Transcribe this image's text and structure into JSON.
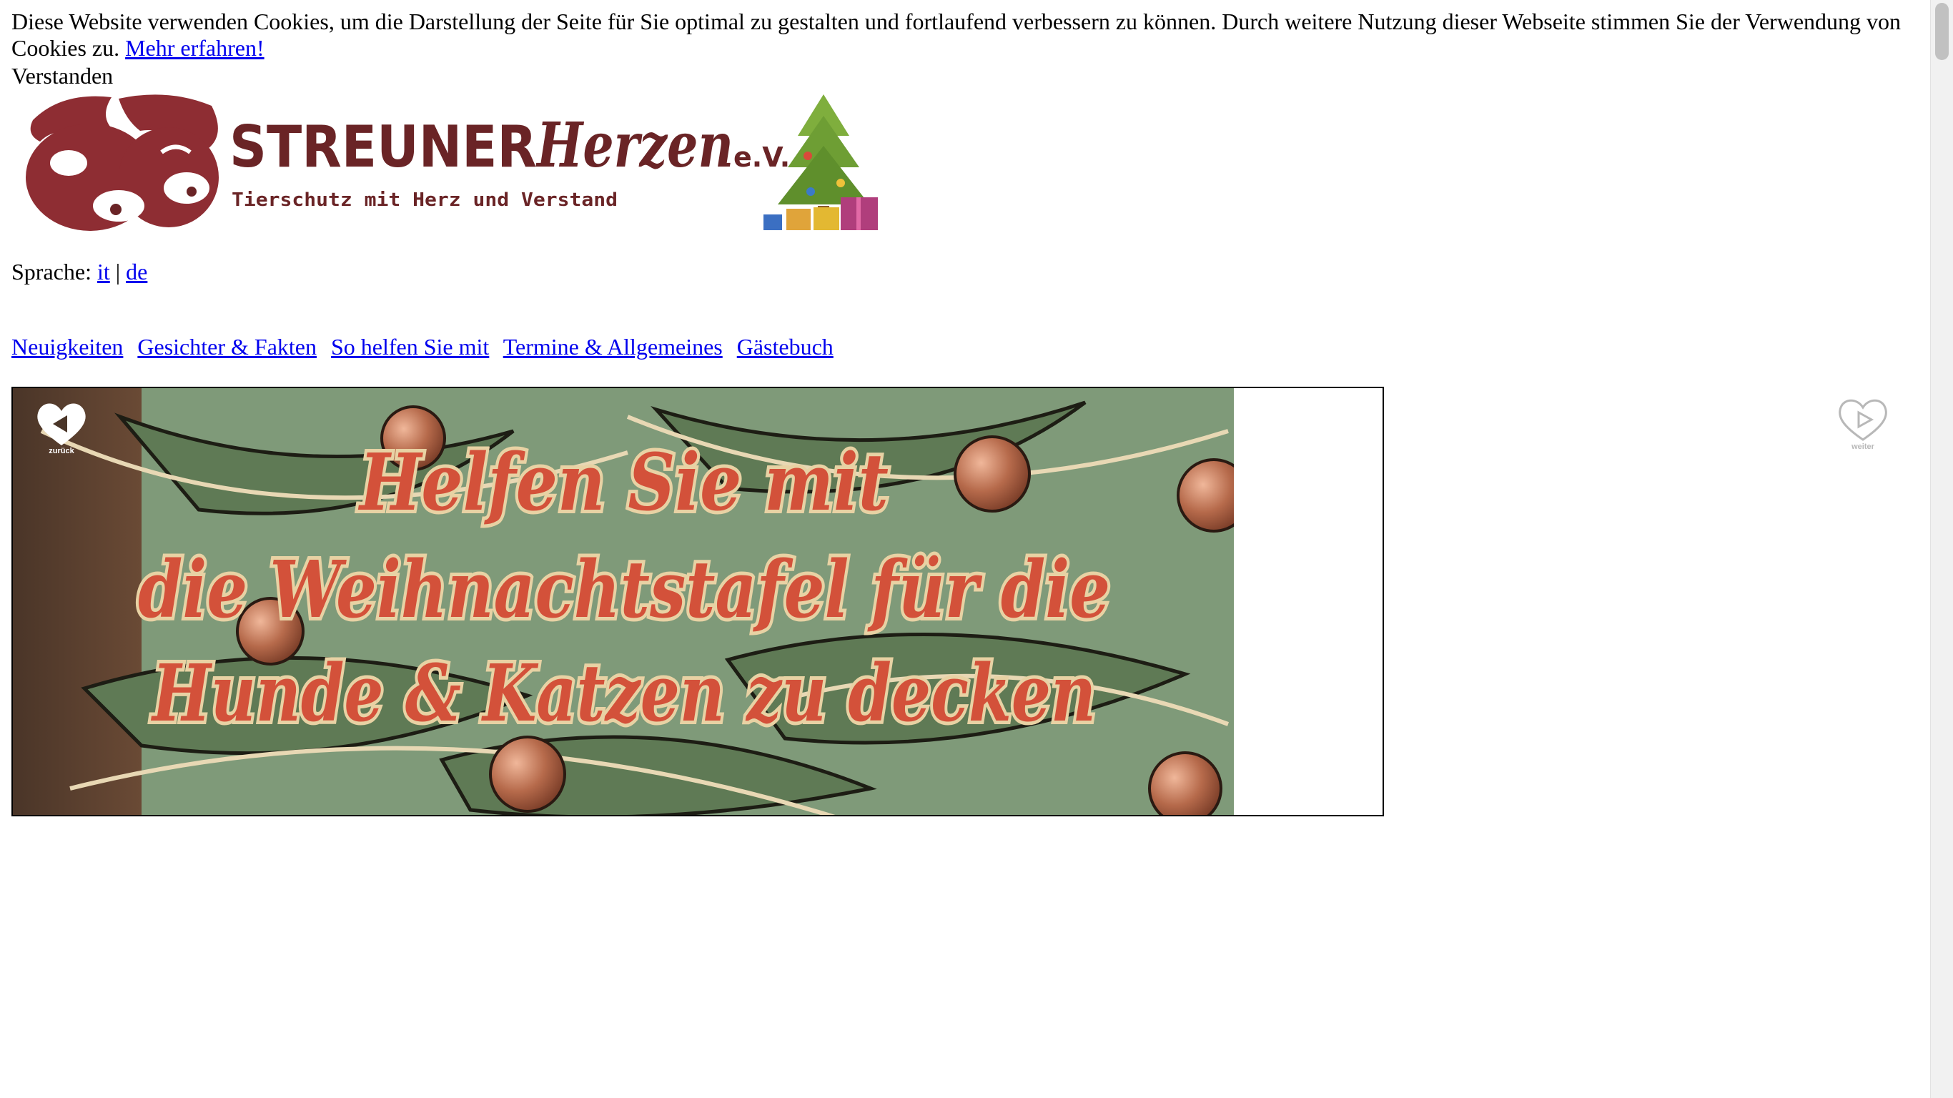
{
  "cookie_banner": {
    "text": "Diese Website verwenden Cookies, um die Darstellung der Seite für Sie optimal zu gestalten und fortlaufend verbessern zu können. Durch weitere Nutzung dieser Webseite stimmen Sie der Verwendung von Cookies zu.",
    "more_link": "Mehr erfahren!",
    "accept_label": "Verstanden"
  },
  "logo": {
    "brand_primary": "STREUNER",
    "brand_script": "Herzen",
    "brand_suffix": "e.V.",
    "tagline": "Tierschutz mit Herz und Verstand",
    "icon": "dog-cat-heads-logo-icon",
    "decoration": "christmas-tree-gifts-icon",
    "brand_color": "#8e2d33",
    "text_color": "#6a2426"
  },
  "language": {
    "label": "Sprache:",
    "separator": "|",
    "options": [
      "it",
      "de"
    ]
  },
  "nav": {
    "items": [
      "Neuigkeiten",
      "Gesichter & Fakten",
      "So helfen Sie mit",
      "Termine & Allgemeines",
      "Gästebuch"
    ]
  },
  "slider": {
    "headline_lines": [
      "Helfen Sie mit",
      "die Weihnachtstafel für die",
      "Hunde & Katzen zu decken"
    ],
    "prev_label": "zurück",
    "next_label": "weiter",
    "prev_icon": "heart-back-arrow-icon",
    "next_icon": "heart-play-arrow-icon",
    "headline_color": "#d3513a"
  }
}
